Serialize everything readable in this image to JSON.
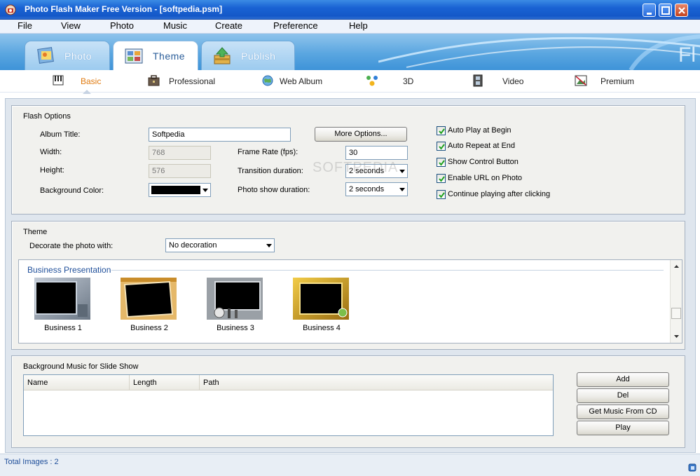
{
  "window": {
    "title": "Photo Flash Maker Free Version - [softpedia.psm]"
  },
  "menu": [
    "File",
    "View",
    "Photo",
    "Music",
    "Create",
    "Preference",
    "Help"
  ],
  "main_tabs": [
    {
      "label": "Photo",
      "icon": "photo-icon"
    },
    {
      "label": "Theme",
      "icon": "theme-icon",
      "active": true
    },
    {
      "label": "Publish",
      "icon": "publish-icon"
    }
  ],
  "sub_tabs": [
    {
      "label": "Basic",
      "icon": "piano-icon",
      "active": true
    },
    {
      "label": "Professional",
      "icon": "briefcase-icon"
    },
    {
      "label": "Web Album",
      "icon": "globe-icon"
    },
    {
      "label": "3D",
      "icon": "molecule-icon"
    },
    {
      "label": "Video",
      "icon": "film-icon"
    },
    {
      "label": "Premium",
      "icon": "picture-icon"
    }
  ],
  "flash_options": {
    "title": "Flash Options",
    "album_title_label": "Album Title:",
    "album_title_value": "Softpedia",
    "width_label": "Width:",
    "width_value": "768",
    "height_label": "Height:",
    "height_value": "576",
    "bg_color_label": "Background Color:",
    "bg_color_value": "#000000",
    "more_options": "More Options...",
    "frame_rate_label": "Frame Rate (fps):",
    "frame_rate_value": "30",
    "transition_label": "Transition duration:",
    "transition_value": "2 seconds",
    "photo_show_label": "Photo show duration:",
    "photo_show_value": "2 seconds",
    "checkboxes": [
      {
        "label": "Auto Play at Begin",
        "checked": true
      },
      {
        "label": "Auto Repeat at End",
        "checked": true
      },
      {
        "label": "Show Control Button",
        "checked": true
      },
      {
        "label": "Enable URL on Photo",
        "checked": true
      },
      {
        "label": "Continue playing after clicking",
        "checked": true
      }
    ]
  },
  "theme": {
    "title": "Theme",
    "decorate_label": "Decorate the photo with:",
    "decorate_value": "No decoration",
    "group": "Business Presentation",
    "items": [
      {
        "label": "Business 1"
      },
      {
        "label": "Business 2"
      },
      {
        "label": "Business 3"
      },
      {
        "label": "Business 4"
      }
    ]
  },
  "music": {
    "title": "Background Music for Slide Show",
    "columns": [
      "Name",
      "Length",
      "Path"
    ],
    "buttons": {
      "add": "Add",
      "del": "Del",
      "get_cd": "Get Music From CD",
      "play": "Play"
    }
  },
  "status": {
    "text": "Total Images : 2"
  },
  "watermark": "SOFTPEDIA",
  "colors": {
    "accent": "#e07b10",
    "titlebar": "#1a63d4",
    "group_header": "#1f4f9a"
  }
}
